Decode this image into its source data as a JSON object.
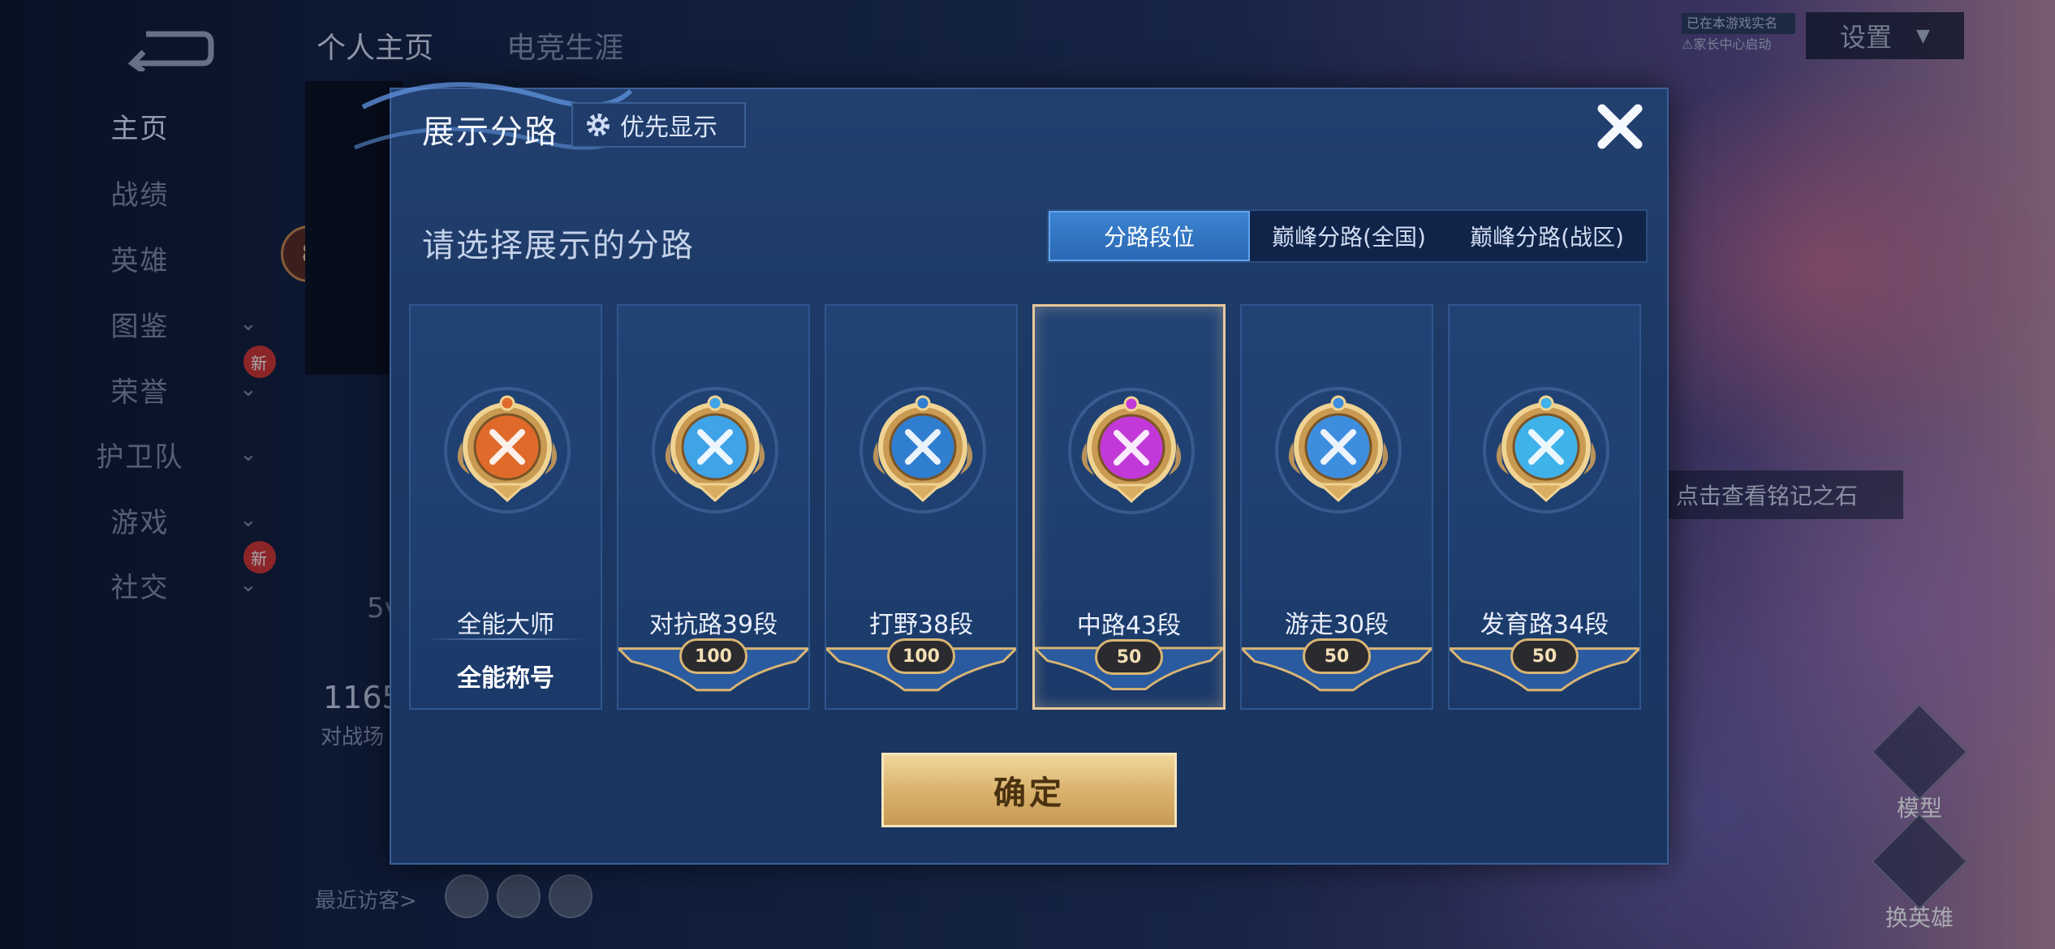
{
  "background": {
    "back_label": "",
    "sidebar": [
      {
        "label": "主页",
        "chevron": false,
        "new": false
      },
      {
        "label": "战绩",
        "chevron": false,
        "new": false
      },
      {
        "label": "英雄",
        "chevron": false,
        "new": false
      },
      {
        "label": "图鉴",
        "chevron": true,
        "new": false
      },
      {
        "label": "荣誉",
        "chevron": true,
        "new": true
      },
      {
        "label": "护卫队",
        "chevron": true,
        "new": false
      },
      {
        "label": "游戏",
        "chevron": true,
        "new": false
      },
      {
        "label": "社交",
        "chevron": true,
        "new": true
      }
    ],
    "new_badge": "新",
    "top_tabs": [
      "个人主页",
      "电竞生涯"
    ],
    "settings_label": "设置",
    "auth_line1": "已在本游戏实名",
    "auth_line2": "⚠家长中心启动",
    "level_badge": "8",
    "partial_text_1": "5v",
    "partial_text_2": "1165",
    "partial_text_3": "对战场",
    "recent_visitors": "最近访客>",
    "inscription_hint": "点击查看铭记之石",
    "model_label": "模型",
    "change_hero_label": "换英雄"
  },
  "dialog": {
    "title": "展示分路",
    "priority_label": "优先显示",
    "subtitle": "请选择展示的分路",
    "tabs": [
      "分路段位",
      "巅峰分路(全国)",
      "巅峰分路(战区)"
    ],
    "active_tab": 0,
    "cards": [
      {
        "name": "全能大师",
        "sub": "全能称号",
        "type": "master",
        "color": "#e06a2a"
      },
      {
        "name": "对抗路39段",
        "badge": "100",
        "type": "lane",
        "color": "#3fa3e8"
      },
      {
        "name": "打野38段",
        "badge": "100",
        "type": "lane",
        "color": "#2f7ed0"
      },
      {
        "name": "中路43段",
        "badge": "50",
        "type": "lane",
        "color": "#c238d8",
        "selected": true
      },
      {
        "name": "游走30段",
        "badge": "50",
        "type": "lane",
        "color": "#3e8ee0"
      },
      {
        "name": "发育路34段",
        "badge": "50",
        "type": "lane",
        "color": "#3fb2ea"
      }
    ],
    "confirm_label": "确定"
  }
}
